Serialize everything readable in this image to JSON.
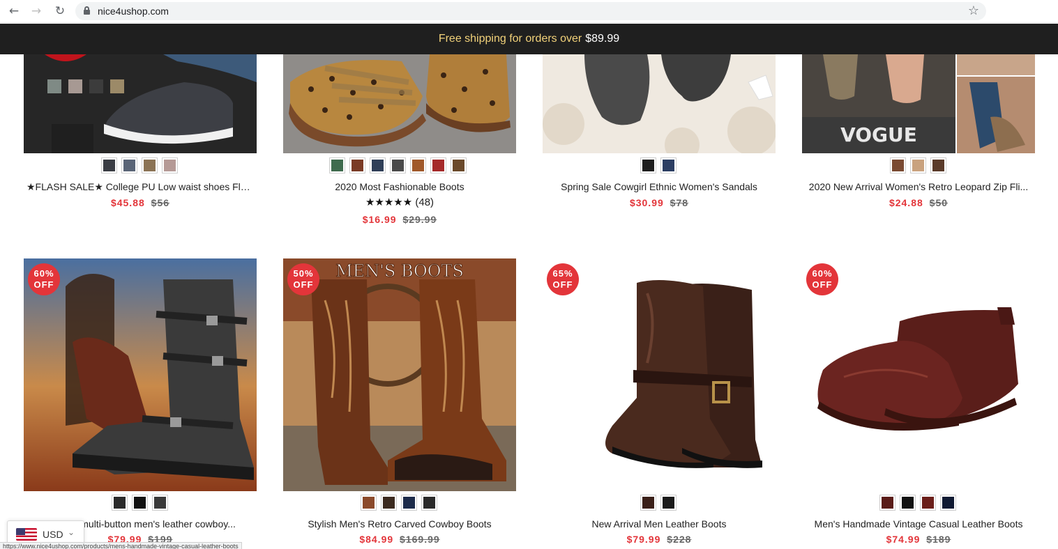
{
  "browser": {
    "url": "nice4ushop.com",
    "status_url": "https://www.nice4ushop.com/products/mens-handmade-vintage-casual-leather-boots"
  },
  "announcement": {
    "text": "Free shipping for orders over",
    "amount": "$89.99"
  },
  "currency": {
    "code": "USD"
  },
  "products_row1": [
    {
      "title": "★FLASH SALE★ College PU Low waist shoes Fla...",
      "price": "$45.88",
      "compare": "$56",
      "swatches": [
        "#3a3d44",
        "#5a6577",
        "#8b7355",
        "#b59a96"
      ]
    },
    {
      "title": "2020 Most Fashionable Boots",
      "price": "$16.99",
      "compare": "$29.99",
      "rating_stars": "★★★★★",
      "rating_count": "(48)",
      "swatches": [
        "#3f6b4e",
        "#7a3b25",
        "#2f3e57",
        "#4a4a4a",
        "#a0592a",
        "#a52a2a",
        "#6b4a2b"
      ]
    },
    {
      "title": "Spring Sale Cowgirl Ethnic Women's Sandals",
      "price": "$30.99",
      "compare": "$78",
      "swatches": [
        "#1e1e1e",
        "#2c3e63"
      ]
    },
    {
      "title": "2020 New Arrival Women's Retro Leopard Zip Fli...",
      "price": "$24.88",
      "compare": "$50",
      "swatches": [
        "#7a4a32",
        "#c9a27e",
        "#5a3b2a"
      ]
    }
  ],
  "products_row2": [
    {
      "title": "Vintage multi-button men's leather cowboy...",
      "price": "$79.99",
      "compare": "$199",
      "badge_pct": "60%",
      "badge_off": "OFF",
      "swatches": [
        "#2a2a2a",
        "#111111",
        "#3a3a3a"
      ]
    },
    {
      "title": "Stylish Men's Retro Carved Cowboy Boots",
      "price": "$84.99",
      "compare": "$169.99",
      "badge_pct": "50%",
      "badge_off": "OFF",
      "image_caption": "MEN'S BOOTS",
      "swatches": [
        "#8b4a2b",
        "#3b2a1f",
        "#1c2b4a",
        "#2a2a2a"
      ]
    },
    {
      "title": "New Arrival Men Leather Boots",
      "price": "$79.99",
      "compare": "$228",
      "badge_pct": "65%",
      "badge_off": "OFF",
      "swatches": [
        "#3a1f18",
        "#1a1a1a"
      ]
    },
    {
      "title": "Men's Handmade Vintage Casual Leather Boots",
      "price": "$74.99",
      "compare": "$189",
      "badge_pct": "60%",
      "badge_off": "OFF",
      "swatches": [
        "#5a1c18",
        "#111111",
        "#6b1f1a",
        "#101a33"
      ]
    }
  ]
}
